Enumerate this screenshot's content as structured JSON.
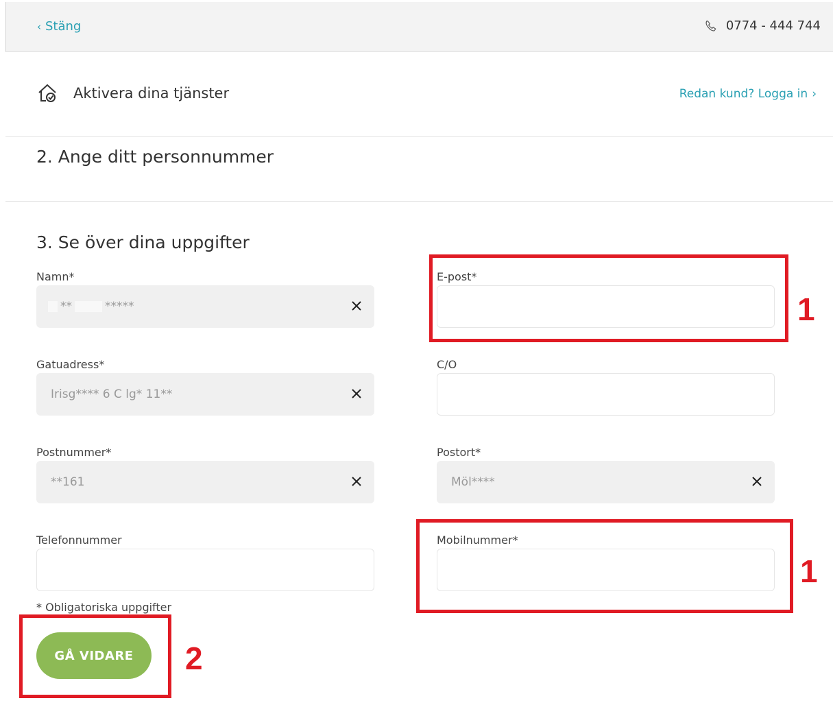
{
  "topbar": {
    "close_label": "Stäng",
    "close_chevron": "‹",
    "phone_icon": "phone-icon",
    "phone_number": "0774 - 444 744"
  },
  "header": {
    "home_icon": "home-check-icon",
    "title": "Aktivera dina tjänster",
    "login_link": "Redan kund? Logga in",
    "login_chevron": "›"
  },
  "step2": {
    "title": "2. Ange ditt personnummer"
  },
  "step3": {
    "title": "3. Se över dina uppgifter",
    "fields": {
      "namn": {
        "label": "Namn*",
        "value_part1": "**",
        "value_part2": "*****"
      },
      "epost": {
        "label": "E-post*",
        "value": ""
      },
      "gatuadress": {
        "label": "Gatuadress*",
        "value": "Irisg**** 6 C lg* 11**"
      },
      "co": {
        "label": "C/O",
        "value": ""
      },
      "postnummer": {
        "label": "Postnummer*",
        "value": "**161"
      },
      "postort": {
        "label": "Postort*",
        "value": "Möl****"
      },
      "telefon": {
        "label": "Telefonnummer",
        "value": ""
      },
      "mobil": {
        "label": "Mobilnummer*",
        "value": ""
      }
    },
    "required_note": "* Obligatoriska uppgifter",
    "submit_label": "GÅ VIDARE"
  },
  "annotations": {
    "email_marker": "1",
    "mobile_marker": "1",
    "submit_marker": "2"
  },
  "colors": {
    "accent": "#2aa0b3",
    "cta": "#8dba55",
    "annotation": "#e01b24"
  }
}
